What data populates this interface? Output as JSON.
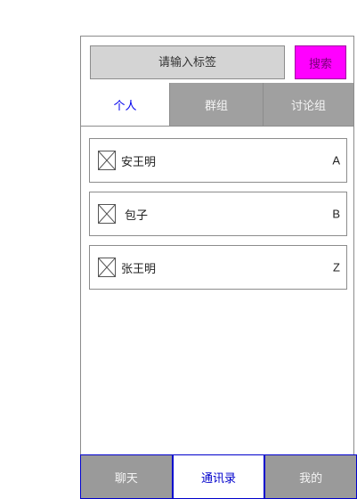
{
  "search": {
    "placeholder": "请输入标签",
    "button_label": "搜索"
  },
  "tabs": [
    {
      "label": "个人",
      "active": true
    },
    {
      "label": "群组",
      "active": false
    },
    {
      "label": "讨论组",
      "active": false
    }
  ],
  "contacts": [
    {
      "name": "安王明",
      "initial": "A",
      "icon": "broken-image-icon"
    },
    {
      "name": "包子",
      "initial": "B",
      "icon": "broken-image-icon"
    },
    {
      "name": "张王明",
      "initial": "Z",
      "icon": "broken-image-icon"
    }
  ],
  "bottom_nav": [
    {
      "label": "聊天",
      "active": false
    },
    {
      "label": "通讯录",
      "active": true
    },
    {
      "label": "我的",
      "active": false
    }
  ],
  "colors": {
    "search_button": "#ff00ff",
    "active_tab_text": "#0000ee",
    "inactive_bg": "#a0a0a0",
    "nav_border": "#0000cc"
  }
}
